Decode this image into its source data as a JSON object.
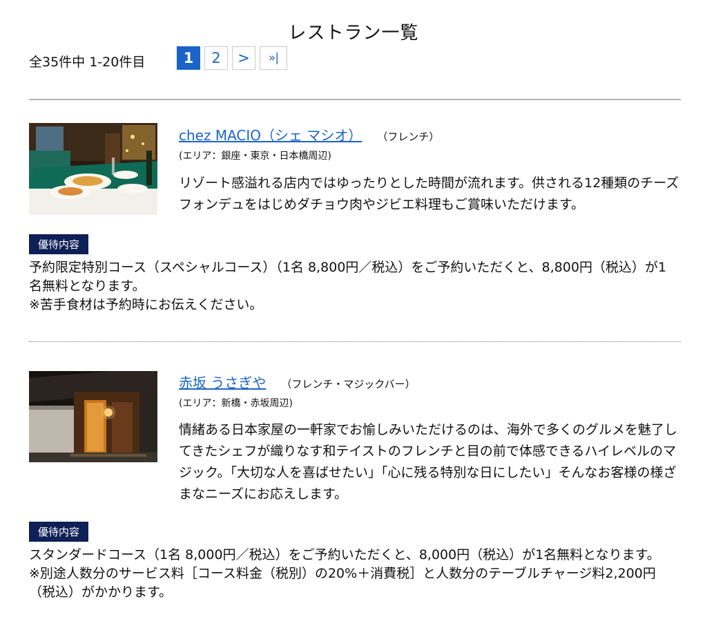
{
  "page": {
    "title": "レストラン一覧",
    "result_count": "全35件中 1-20件目"
  },
  "pagination": {
    "current": "1",
    "page2": "2",
    "next": ">",
    "last": "»|"
  },
  "restaurants": [
    {
      "name": "chez MACIO（シェ マシオ）",
      "genre": "（フレンチ）",
      "area": "(エリア：銀座・東京・日本橋周辺)",
      "description": "リゾート感溢れる店内ではゆったりとした時間が流れます。供される12種類のチーズフォンデュをはじめダチョウ肉やジビエ料理もご賞味いただけます。",
      "badge": "優待内容",
      "benefit": [
        "予約限定特別コース（スペシャルコース）（1名 8,800円／税込）をご予約いただくと、8,800円（税込）が1名無料となります。",
        "※苦手食材は予約時にお伝えください。"
      ]
    },
    {
      "name": "赤坂 うさぎや",
      "genre": "（フレンチ・マジックバー）",
      "area": "(エリア：新橋・赤坂周辺)",
      "description": "情緒ある日本家屋の一軒家でお愉しみいただけるのは、海外で多くのグルメを魅了してきたシェフが織りなす和テイストのフレンチと目の前で体感できるハイレベルのマジック。「大切な人を喜ばせたい」「心に残る特別な日にしたい」そんなお客様の様ざまなニーズにお応えします。",
      "badge": "優待内容",
      "benefit": [
        "スタンダードコース（1名 8,000円／税込）をご予約いただくと、8,000円（税込）が1名無料となります。",
        "※別途人数分のサービス料［コース料金（税別）の20%＋消費税］と人数分のテーブルチャージ料2,200円（税込）がかかります。"
      ]
    }
  ],
  "colors": {
    "link": "#1a64c8",
    "badge_bg": "#0e2055",
    "divider": "#b3b3b3"
  }
}
